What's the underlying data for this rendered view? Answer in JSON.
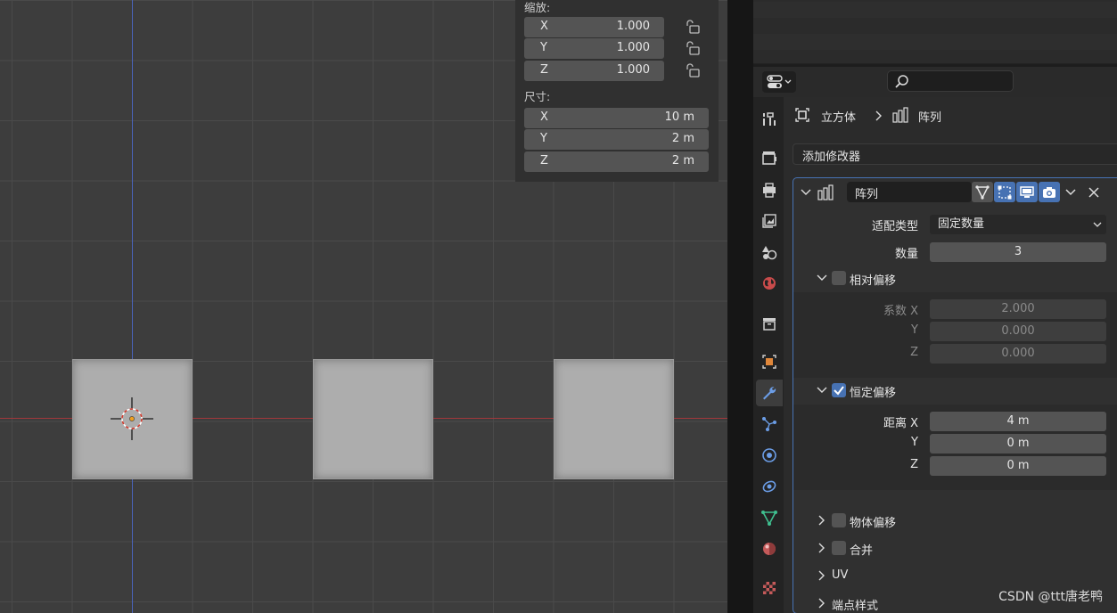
{
  "viewport": {
    "transform_panel": {
      "scale_label": "缩放:",
      "scale": [
        {
          "axis": "X",
          "value": "1.000"
        },
        {
          "axis": "Y",
          "value": "1.000"
        },
        {
          "axis": "Z",
          "value": "1.000"
        }
      ],
      "dimensions_label": "尺寸:",
      "dimensions": [
        {
          "axis": "X",
          "value": "10 m"
        },
        {
          "axis": "Y",
          "value": "2 m"
        },
        {
          "axis": "Z",
          "value": "2 m"
        }
      ]
    }
  },
  "properties": {
    "breadcrumb": {
      "object": "立方体",
      "modifier": "阵列"
    },
    "add_modifier_label": "添加修改器",
    "modifier": {
      "name": "阵列",
      "fit_type_label": "适配类型",
      "fit_type_value": "固定数量",
      "count_label": "数量",
      "count_value": "3",
      "relative_offset": {
        "title": "相对偏移",
        "enabled": false,
        "factor_x_label": "系数 X",
        "factor_x": "2.000",
        "y_label": "Y",
        "factor_y": "0.000",
        "z_label": "Z",
        "factor_z": "0.000"
      },
      "constant_offset": {
        "title": "恒定偏移",
        "enabled": true,
        "distance_x_label": "距离 X",
        "distance_x": "4 m",
        "y_label": "Y",
        "distance_y": "0 m",
        "z_label": "Z",
        "distance_z": "0 m"
      },
      "object_offset_title": "物体偏移",
      "merge_title": "合并",
      "uv_title": "UV",
      "caps_title": "端点样式"
    }
  },
  "watermark": "CSDN @ttt唐老鸭",
  "colors": {
    "accent": "#4772b3",
    "x_axis": "#a2383c",
    "y_axis": "#4a63b8",
    "cube": "#adadad"
  }
}
